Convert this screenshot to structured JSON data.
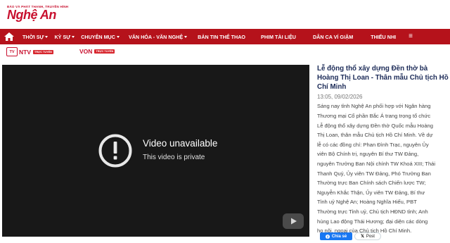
{
  "site": {
    "logo_tagline": "BÁO VÀ PHÁT THANH, TRUYỀN HÌNH",
    "logo_name": "Nghệ An",
    "brand_color": "#b5121b"
  },
  "nav": {
    "items": [
      {
        "label": "THỜI SỰ",
        "dropdown": true
      },
      {
        "label": "KỲ SỰ",
        "dropdown": true
      },
      {
        "label": "CHUYÊN MỤC",
        "dropdown": true
      },
      {
        "label": "VĂN HÓA - VĂN NGHỆ",
        "dropdown": true
      },
      {
        "label": "BẢN TIN THỂ THAO",
        "dropdown": false
      },
      {
        "label": "PHIM TÀI LIỆU",
        "dropdown": false
      },
      {
        "label": "DÂN CA VÍ GIẶM",
        "dropdown": false
      },
      {
        "label": "THIẾU NHI",
        "dropdown": false
      }
    ],
    "menu_icon": "≡"
  },
  "live": {
    "ntv_icon_text": "TV",
    "ntv_label": "NTV",
    "ntv_badge": "TRỰC TUYẾN",
    "von_label": "VON",
    "von_badge": "TRỰC TUYẾN"
  },
  "video": {
    "error_title": "Video unavailable",
    "error_sub": "This video is private"
  },
  "article": {
    "title_lines": [
      "Lễ động thổ xây dựng Đền thờ bà",
      "Hoàng Thị Loan - Thân mẫu Chủ tịch Hồ",
      "Chí Minh"
    ],
    "time": "13:05, 09/02/2026",
    "body_lines": [
      "Sáng nay tỉnh Nghệ An phối hợp với Ngân hàng",
      "Thương mại Cổ phần Bắc Á trang trọng tổ chức",
      "Lễ động thổ xây dựng Đền thờ Quốc mẫu Hoàng",
      "Thị Loan, thân mẫu Chủ tịch Hồ Chí Minh. Về dự",
      "lễ có các đồng chí: Phan Đình Trạc, nguyên Ủy",
      "viên Bộ Chính trị, nguyên Bí thư TW Đảng,",
      "nguyên Trưởng Ban Nội chính TW Khoá XIII; Thái",
      "Thanh Quý, Ủy viên TW Đảng, Phó Trưởng Ban",
      "Thường trực Ban Chính sách Chiến lược TW;",
      "Nguyễn Khắc Thận, Ủy viên TW Đảng, Bí thư",
      "Tỉnh uỷ Nghệ An; Hoàng Nghĩa Hiếu, PBT",
      "Thường trực Tỉnh uỷ, Chủ tịch HĐND tỉnh; Anh",
      "hùng Lao động Thái Hương; đại diện các dòng",
      "họ nội, ngoại của Chủ tịch Hồ Chí Minh."
    ]
  },
  "share": {
    "facebook": "Chia sẻ",
    "x_post": "Post"
  }
}
